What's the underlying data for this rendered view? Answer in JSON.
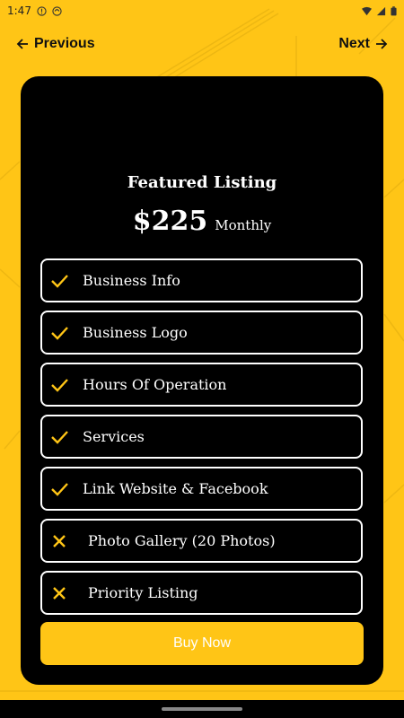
{
  "status_bar": {
    "time": "1:47"
  },
  "nav": {
    "previous_label": "Previous",
    "next_label": "Next"
  },
  "plan": {
    "title": "Featured Listing",
    "price": "$225",
    "period": "Monthly"
  },
  "features": [
    {
      "label": "Business Info",
      "included": true,
      "icon": "check-icon"
    },
    {
      "label": "Business Logo",
      "included": true,
      "icon": "check-icon"
    },
    {
      "label": "Hours Of Operation",
      "included": true,
      "icon": "check-icon"
    },
    {
      "label": "Services",
      "included": true,
      "icon": "check-icon"
    },
    {
      "label": "Link Website & Facebook",
      "included": true,
      "icon": "check-icon"
    },
    {
      "label": "Photo Gallery (20 Photos)",
      "included": false,
      "icon": "close-icon"
    },
    {
      "label": "Priority Listing",
      "included": false,
      "icon": "close-icon"
    }
  ],
  "buy_button": {
    "label": "Buy Now"
  },
  "colors": {
    "accent": "#FFC516",
    "card": "#000000",
    "text_light": "#FFFFFF"
  }
}
